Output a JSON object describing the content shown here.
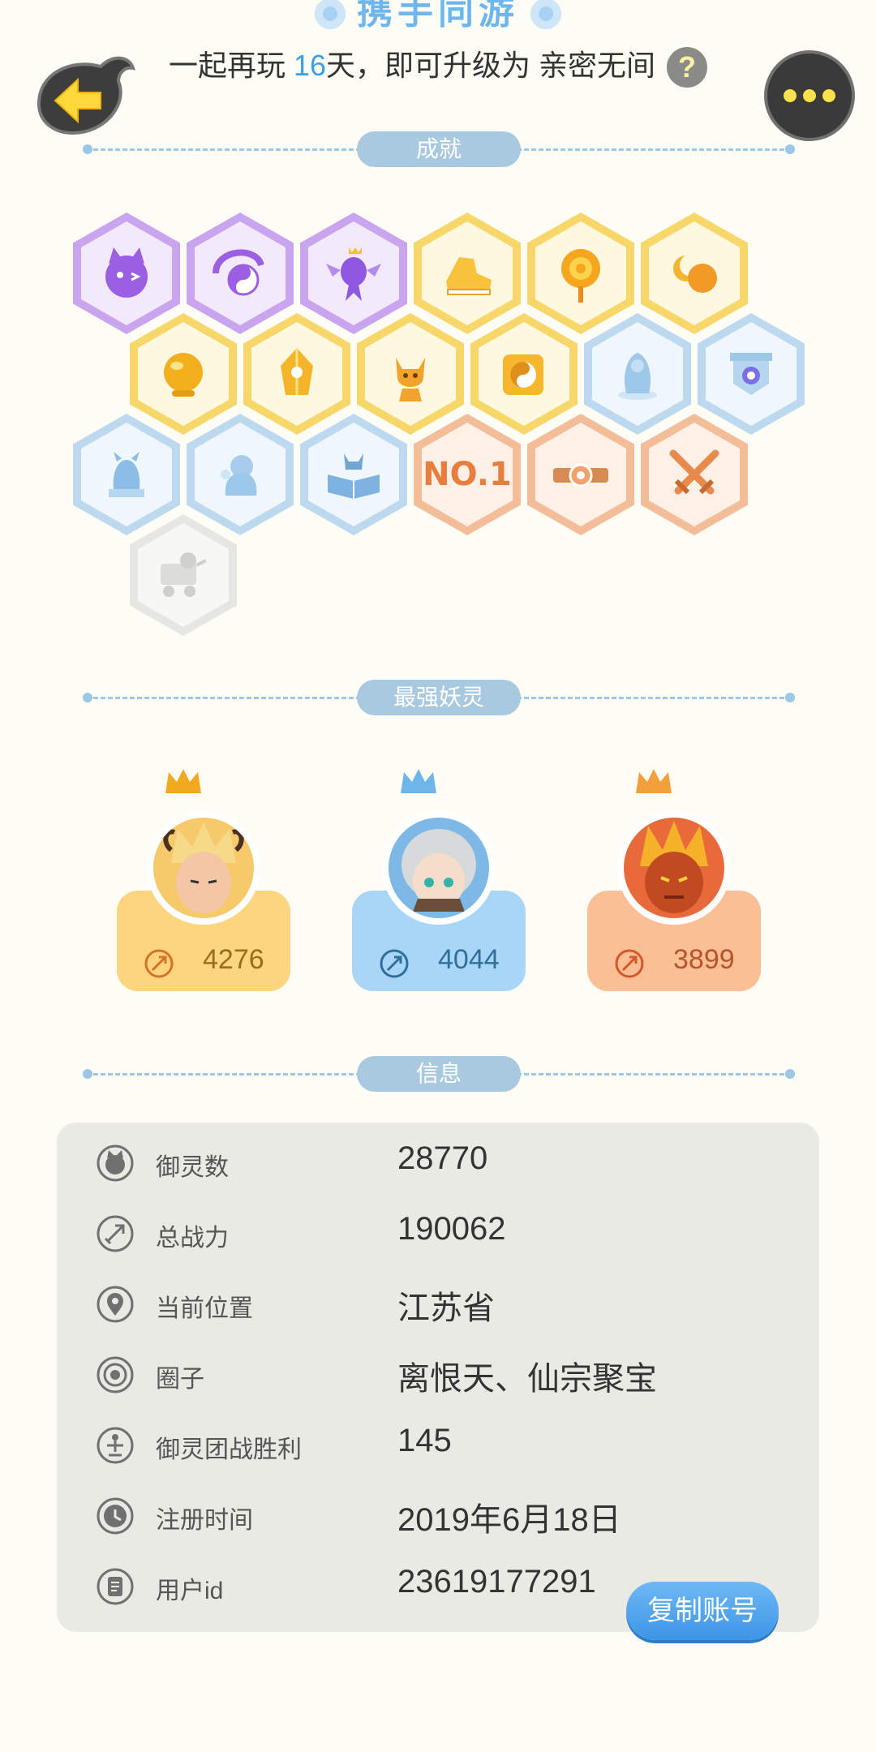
{
  "header": {
    "title": "携手同游",
    "subtitle_prefix": "一起再玩",
    "subtitle_days": "16",
    "subtitle_suffix": "天，即可升级为 亲密无间",
    "help_badge": "?"
  },
  "sections": {
    "achievements": "成就",
    "strongest": "最强妖灵",
    "info": "信息"
  },
  "achievements": [
    {
      "color": "purple",
      "icon": "devil-cat-icon"
    },
    {
      "color": "purple",
      "icon": "yin-yang-swirl-icon"
    },
    {
      "color": "purple",
      "icon": "crowned-fish-icon"
    },
    {
      "color": "yellow",
      "icon": "sneaker-icon"
    },
    {
      "color": "yellow",
      "icon": "sun-mirror-icon"
    },
    {
      "color": "yellow",
      "icon": "moon-sun-icon"
    },
    {
      "color": "yellow",
      "icon": "gold-orb-icon"
    },
    {
      "color": "yellow",
      "icon": "gold-crystal-icon"
    },
    {
      "color": "yellow",
      "icon": "fox-spirit-icon"
    },
    {
      "color": "yellow",
      "icon": "taiji-scroll-icon"
    },
    {
      "color": "blue",
      "icon": "spirit-statue-icon"
    },
    {
      "color": "blue",
      "icon": "eye-shield-icon"
    },
    {
      "color": "blue",
      "icon": "beast-statue-icon"
    },
    {
      "color": "blue",
      "icon": "crystal-pet-icon"
    },
    {
      "color": "blue",
      "icon": "open-book-icon"
    },
    {
      "color": "orange",
      "icon": "no1-badge-icon",
      "text": "NO.1"
    },
    {
      "color": "orange",
      "icon": "belt-buckle-icon"
    },
    {
      "color": "orange",
      "icon": "crossed-swords-icon"
    },
    {
      "color": "gray",
      "icon": "cat-cart-icon"
    }
  ],
  "strongest": [
    {
      "power": "4276",
      "theme": "yellow"
    },
    {
      "power": "4044",
      "theme": "blue"
    },
    {
      "power": "3899",
      "theme": "orange"
    }
  ],
  "info": {
    "rows": [
      {
        "label": "御灵数",
        "value": "28770",
        "icon": "spirit-count-icon"
      },
      {
        "label": "总战力",
        "value": "190062",
        "icon": "sword-power-icon"
      },
      {
        "label": "当前位置",
        "value": "江苏省",
        "icon": "location-pin-icon"
      },
      {
        "label": "圈子",
        "value": "离恨天、仙宗聚宝",
        "icon": "circle-target-icon"
      },
      {
        "label": "御灵团战胜利",
        "value": "145",
        "icon": "team-victory-icon"
      },
      {
        "label": "注册时间",
        "value": "2019年6月18日",
        "icon": "clock-icon"
      },
      {
        "label": "用户id",
        "value": "23619177291",
        "icon": "id-book-icon"
      }
    ],
    "copy_button": "复制账号"
  },
  "colors": {
    "accent_blue": "#3aa0e6",
    "pill": "#a9c9e0",
    "background": "#fdfcf5",
    "card": "#eaeae4"
  }
}
